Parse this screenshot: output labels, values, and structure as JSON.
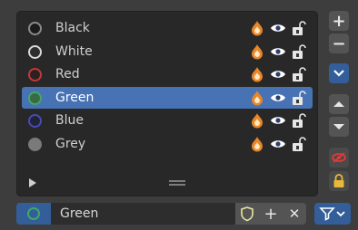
{
  "layers": [
    {
      "name": "Black",
      "color": "#1a1a1a",
      "ring": "#8a8a8a",
      "selected": false
    },
    {
      "name": "White",
      "color": "#2e2e2e",
      "ring": "#d8d8d8",
      "selected": false
    },
    {
      "name": "Red",
      "color": "#2e2020",
      "ring": "#c0393b",
      "selected": false
    },
    {
      "name": "Green",
      "color": "#3a6a45",
      "ring": "#3fa866",
      "selected": true
    },
    {
      "name": "Blue",
      "color": "#20243a",
      "ring": "#4a4ab0",
      "selected": false
    },
    {
      "name": "Grey",
      "color": "#7a7a7a",
      "ring": "#7a7a7a",
      "selected": false
    }
  ],
  "side_buttons": {
    "add": "+",
    "remove": "−",
    "dropdown": "chevron-down-icon",
    "move_up": "triangle-up-icon",
    "move_down": "triangle-down-icon",
    "hide": "eye-off-icon",
    "lock": "lock-icon"
  },
  "active_layer": {
    "name": "Green",
    "ring": "#3fa866"
  },
  "bottom_icons": {
    "plus": "+",
    "close": "✕"
  },
  "colors": {
    "selection": "#4772b3",
    "accent_blue": "#335e99",
    "icon_orange": "#e8862a"
  }
}
